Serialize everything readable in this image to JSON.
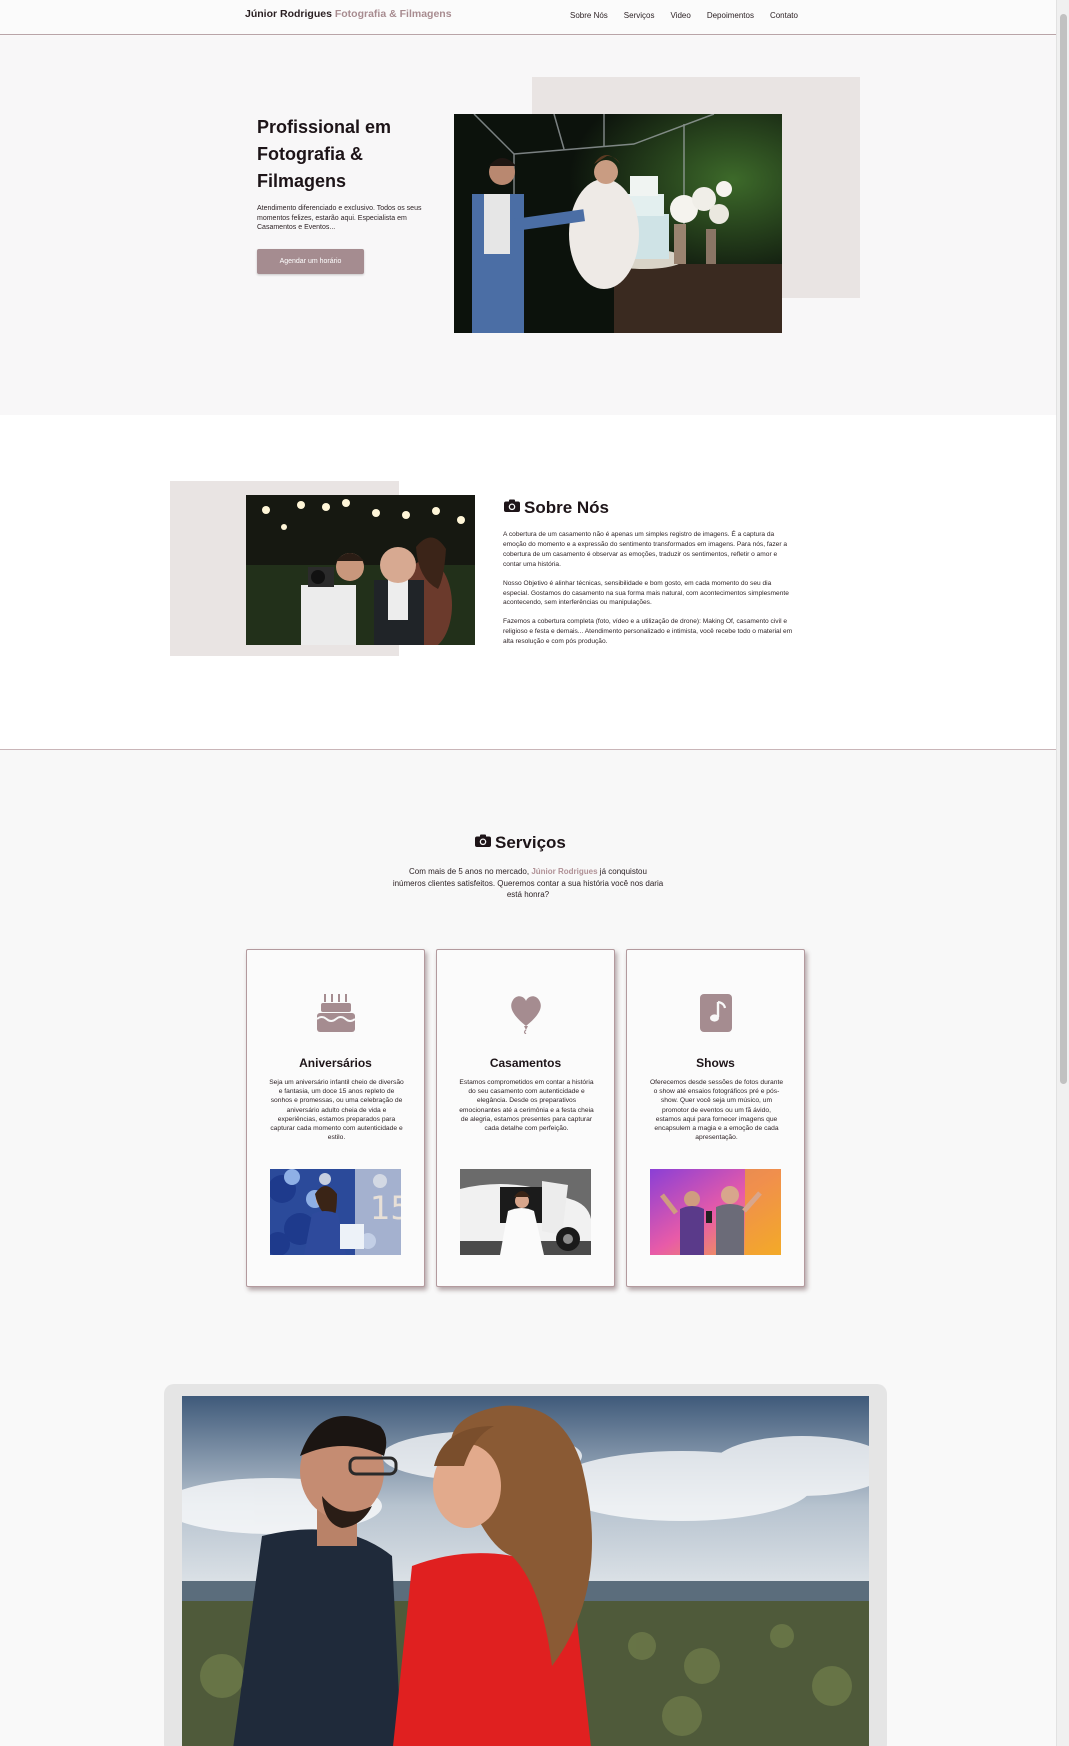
{
  "header": {
    "brand_name": "Júnior Rodrigues",
    "brand_tagline": "Fotografia & Filmagens",
    "nav": [
      "Sobre Nós",
      "Serviços",
      "Video",
      "Depoimentos",
      "Contato"
    ]
  },
  "hero": {
    "title": "Profissional em Fotografia & Filmagens",
    "subtitle": "Atendimento diferenciado e exclusivo. Todos os seus momentos felizes, estarão aqui. Especialista em Casamentos e Eventos...",
    "cta_label": "Agendar um horário"
  },
  "about": {
    "title": "Sobre Nós",
    "paragraphs": [
      "A cobertura de um casamento não é apenas um simples registro de imagens. É a captura da emoção do momento e a expressão do sentimento transformados em imagens. Para nós, fazer a cobertura de um casamento é observar as emoções, traduzir os sentimentos, refletir o amor e contar uma história.",
      "Nosso Objetivo é alinhar técnicas, sensibilidade e bom gosto, em cada momento do seu dia especial. Gostamos do casamento na sua forma mais natural, com acontecimentos simplesmente acontecendo, sem interferências ou manipulações.",
      "Fazemos a cobertura completa (foto, vídeo e a utilização de drone): Making Of, casamento civil e religioso e festa e demais... Atendimento personalizado e intimista, você recebe todo o material em alta resolução e com pós produção."
    ]
  },
  "services": {
    "title": "Serviços",
    "intro_before": "Com mais de 5 anos no mercado,",
    "intro_name": "Júnior Rodrigues",
    "intro_after": "já conquistou inúmeros clientes satisfeitos. Queremos contar a sua história você nos daria está honra?",
    "cards": [
      {
        "title": "Aniversários",
        "icon": "cake-icon",
        "text": "Seja um aniversário infantil cheio de diversão e fantasia, um doce 15 anos repleto de sonhos e promessas, ou uma celebração de aniversário adulto cheia de vida e experiências, estamos preparados para capturar cada momento com autenticidade e estilo."
      },
      {
        "title": "Casamentos",
        "icon": "heart-balloon-icon",
        "text": "Estamos comprometidos em contar a história do seu casamento com autenticidade e elegância. Desde os preparativos emocionantes até a cerimônia e a festa cheia de alegria, estamos presentes para capturar cada detalhe com perfeição."
      },
      {
        "title": "Shows",
        "icon": "music-note-icon",
        "text": "Oferecemos desde sessões de fotos durante o show até ensaios fotográficos pré e pós-show. Quer você seja um músico, um promotor de eventos ou um fã ávido, estamos aqui para fornecer imagens que encapsulem a magia e a emoção de cada apresentação."
      }
    ]
  },
  "colors": {
    "accent": "#a58c90",
    "block": "#e9e4e3",
    "text": "#2a1f22"
  }
}
